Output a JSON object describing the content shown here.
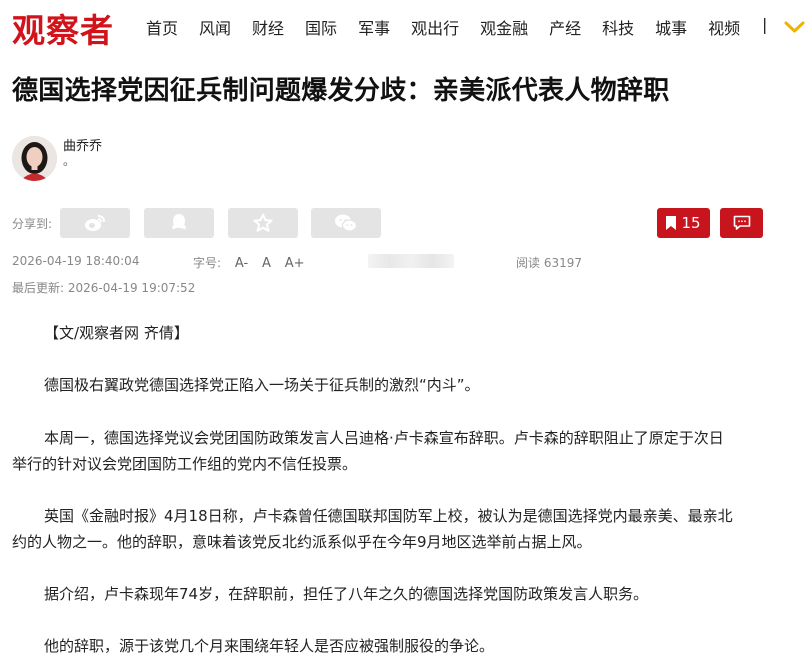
{
  "site": {
    "logo_text": "观察者",
    "brand_color": "#d1141b"
  },
  "nav": {
    "items": [
      "首页",
      "风闻",
      "财经",
      "国际",
      "军事",
      "观出行",
      "观金融",
      "产经",
      "科技",
      "城事",
      "视频"
    ],
    "separator": "|"
  },
  "article": {
    "title": "德国选择党因征兵制问题爆发分歧：亲美派代表人物辞职",
    "author": {
      "name": "曲乔乔",
      "desc": "。"
    },
    "share_label": "分享到:",
    "share_icons": [
      "weibo-icon",
      "qq-icon",
      "star-icon",
      "wechat-icon"
    ],
    "bookmark_count": "15",
    "published": "2026-04-19 18:40:04",
    "fontsize_label": "字号:",
    "fontsize_options": [
      "A-",
      "A",
      "A+"
    ],
    "reads_label": "阅读",
    "reads_count": "63197",
    "updated_label": "最后更新:",
    "updated": "2026-04-19 19:07:52",
    "paragraphs": {
      "p0": "【文/观察者网 齐倩】",
      "p1": "德国极右翼政党德国选择党正陷入一场关于征兵制的激烈“内斗”。",
      "p2a": "本周一，德国选择党议会党团国防政策发言人吕迪格·卢卡森宣布辞职。卢卡森的辞职阻止了原定于次日",
      "p2b": "举行的针对议会党团国防工作组的党内不信任投票。",
      "p3a": "英国《金融时报》4月18日称，卢卡森曾任德国联邦国防军上校，被认为是德国选择党内最亲美、最亲北",
      "p3b": "约的人物之一。他的辞职，意味着该党反北约派系似乎在今年9月地区选举前占据上风。",
      "p4": "据介绍，卢卡森现年74岁，在辞职前，担任了八年之久的德国选择党国防政策发言人职务。",
      "p5": "他的辞职，源于该党几个月来围绕年轻人是否应被强制服役的争论。"
    }
  }
}
